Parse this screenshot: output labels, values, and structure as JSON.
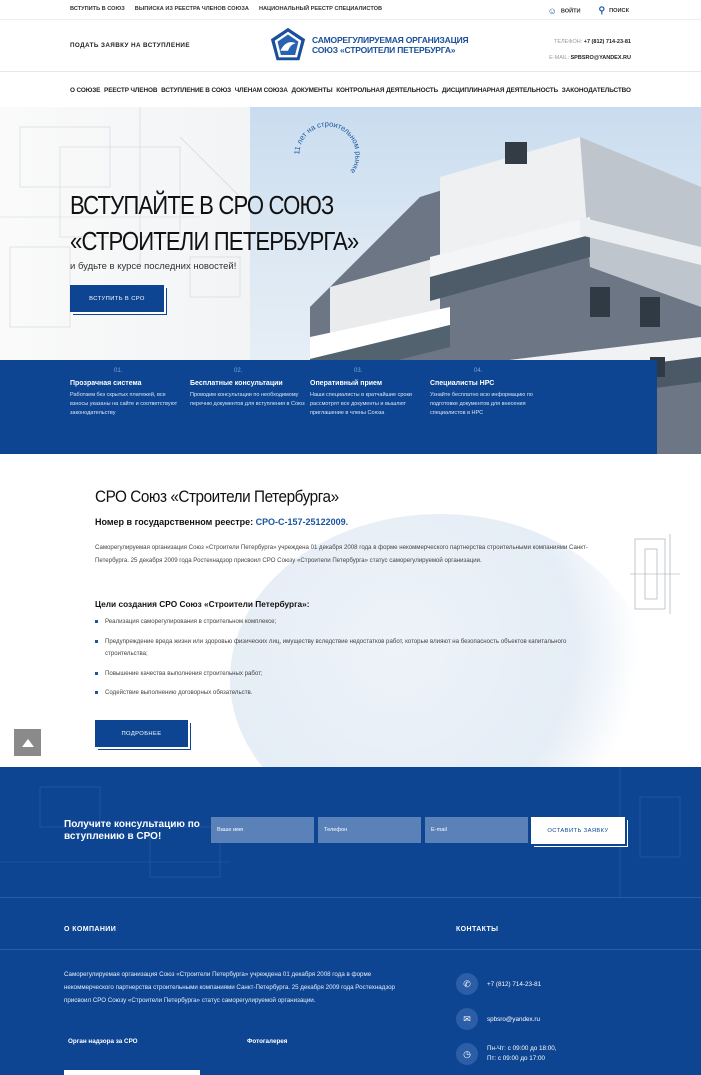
{
  "topbar": {
    "links": [
      "Вступить в союз",
      "Выписка из реестра членов союза",
      "Национальный реестр специалистов"
    ],
    "login": "ВОЙТИ",
    "search": "ПОИСК"
  },
  "header": {
    "apply_label": "ПОДАТЬ ЗАЯВКУ НА ВСТУПЛЕНИЕ",
    "logo_line1": "САМОРЕГУЛИРУЕМАЯ ОРГАНИЗАЦИЯ",
    "logo_line2": "СОЮЗ «СТРОИТЕЛИ ПЕТЕРБУРГА»",
    "phone_label": "ТЕЛЕФОН:",
    "phone": "+7 (812) 714-23-81",
    "email_label": "E-MAIL:",
    "email": "SPBSRO@YANDEX.RU"
  },
  "nav": [
    "О СОЮЗЕ",
    "РЕЕСТР ЧЛЕНОВ",
    "ВСТУПЛЕНИЕ В СОЮЗ",
    "ЧЛЕНАМ СОЮЗА",
    "ДОКУМЕНТЫ",
    "КОНТРОЛЬНАЯ ДЕЯТЕЛЬНОСТЬ",
    "ДИСЦИПЛИНАРНАЯ ДЕЯТЕЛЬНОСТЬ",
    "ЗАКОНОДАТЕЛЬСТВО"
  ],
  "hero": {
    "title_line1": "ВСТУПАЙТЕ В СРО СОЮЗ",
    "title_line2": "«СТРОИТЕЛИ ПЕТЕРБУРГА»",
    "subtitle": "и будьте в курсе последних новостей!",
    "button": "ВСТУПИТЬ В СРО",
    "stamp": "11 лет на строительном рынке"
  },
  "features": [
    {
      "num": "01.",
      "title": "Прозрачная система",
      "desc": "Работаем без скрытых платежей, все взносы указаны на сайте и соответствуют законодательству"
    },
    {
      "num": "02.",
      "title": "Бесплатные консультации",
      "desc": "Проводим консультации по необходимому перечню документов для вступления в Союз"
    },
    {
      "num": "03.",
      "title": "Оперативный прием",
      "desc": "Наши специалисты в кратчайшие сроки рассмотрят все документы и вышлют приглашение в члены Союза"
    },
    {
      "num": "04.",
      "title": "Специалисты НРС",
      "desc": "Узнайте бесплатно всю информацию по подготовке документов для внесения специалистов в НРС"
    }
  ],
  "about": {
    "title": "СРО Союз «Строители Петербурга»",
    "reg_label": "Номер в государственном реестре:",
    "reg_number": "СРО-С-157-25122009.",
    "intro": "Саморегулируемая организация Союз «Строители Петербурга» учреждена 01 декабря 2008 года в форме некоммерческого партнерства строительными компаниями Санкт-Петербурга. 25 декабря 2009 года Ростехнадзор присвоил СРО Союзу «Строители Петербурга» статус саморегулируемой организации.",
    "goals_title": "Цели создания СРО Союз «Строители Петербурга»:",
    "goals": [
      "Реализация саморегулирования в строительном комплексе;",
      "Предупреждение вреда жизни или здоровью физических лиц, имуществу вследствие недостатков работ, которые влияют на безопасность объектов капитального строительства;",
      "Повышение качества выполнения строительных работ;",
      "Содействие выполнению договорных обязательств."
    ],
    "more_button": "ПОДРОБНЕЕ"
  },
  "consult": {
    "label": "Получите консультацию по вступлению в СРО!",
    "name_placeholder": "Ваше имя",
    "phone_placeholder": "Телефон",
    "email_placeholder": "E-mail",
    "submit": "ОСТАВИТЬ ЗАЯВКУ"
  },
  "footer": {
    "about_heading": "О КОМПАНИИ",
    "contacts_heading": "КОНТАКТЫ",
    "about_text": "Саморегулируемая организация Союз «Строители Петербурга» учреждена 01 декабря 2008 года в форме некоммерческого партнерства строительными компаниями Санкт-Петербурга. 25 декабря 2009 года Ростехнадзор присвоил СРО Союзу «Строители Петербурга» статус саморегулируемой организации.",
    "link_supervision": "Орган надзора за СРО",
    "link_gallery": "Фотогалерея",
    "phone": "+7 (812) 714-23-81",
    "email": "spbsro@yandex.ru",
    "hours_line1": "Пн-Чт: с 09:00 до 18:00,",
    "hours_line2": "Пт: с 09:00 до 17:00"
  },
  "colors": {
    "brand_blue": "#0d4592",
    "accent_blue": "#1a56a0"
  }
}
